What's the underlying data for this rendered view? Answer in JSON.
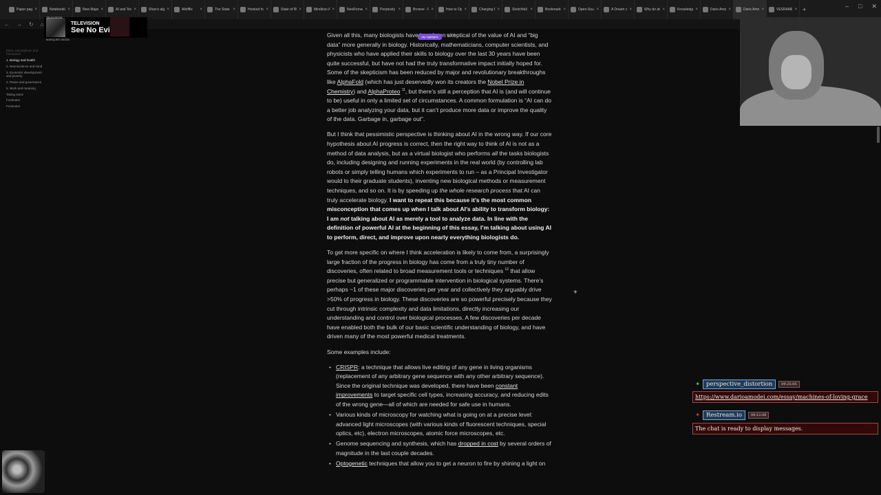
{
  "tabs": [
    "Paper page -",
    "NotebookLM",
    "New Major Tr",
    "AI and Techn",
    "Shan's algorit",
    "Allofflix",
    "The State of A",
    "Hooked for al",
    "State of RL fo",
    "Mindless AI",
    "NeoRomant",
    "Perplexity - Tec",
    "Browse - Rich",
    "How to Opti",
    "Charging Bui",
    "Sketchfall on X",
    "Bookmarks",
    "Open-Source",
    "A Dream of S",
    "Why do atten",
    "Knowledge G",
    "Dario Amodei",
    "Dario Amodei",
    "VESRAME A"
  ],
  "browser": {
    "url_fragment": "dario"
  },
  "now_playing": {
    "band": "TELEVISION",
    "song": "See No Evil",
    "art_top": "TELEVISION",
    "art_bottom": "MARQUEE MOON"
  },
  "toc": {
    "items": [
      "Basic assumptions and framework",
      "1. Biology and health",
      "2. Neuroscience and mind",
      "3. Economic development and poverty",
      "4. Peace and governance",
      "5. Work and meaning",
      "Taking stock",
      "Footnotes",
      "Footnotes"
    ]
  },
  "clip": {
    "highlight_label": "clip highlights",
    "tools": "↕ ⧉  × ⎘"
  },
  "article": {
    "p1": {
      "a": "Given all this, many biologists have long been skeptical of the value of AI and “big data” more generally in biology. Historically, mathematicians, computer scientists, and physicists who have applied their skills to biology over the last 30 years have been quite successful, but have not had the truly transformative impact initially hoped for. Some of the skepticism has been reduced by major and revolutionary breakthroughs like ",
      "link1": "AlphaFold",
      "b": " (which has just deservedly won its creators the ",
      "link2": "Nobel Prize in Chemistry",
      "c": ") and ",
      "link3": "AlphaProteo",
      "sup": "11",
      "d": ", but there’s still a perception that AI is (and will continue to be) useful in only a limited set of circumstances. A common formulation is “AI can do a better job analyzing your data, but it can’t produce more data or improve the quality of the data. Garbage in, garbage out”."
    },
    "p2": {
      "a": "But I think that pessimistic perspective is thinking about AI in the wrong way. If our core hypothesis about AI progress is correct, then the right way to think of AI is not as a method of data analysis, but as a virtual biologist who performs ",
      "em1": "all",
      "b": " the tasks biologists do, including designing and running experiments in the real world (by controlling lab robots or simply telling humans which experiments to run – as a Principal Investigator would to their graduate students), inventing new biological methods or measurement techniques, and so on. It is by speeding up ",
      "em2": "the whole research process",
      "c": " that AI can truly accelerate biology. ",
      "bold1": "I want to repeat this because it’s the most common misconception that comes up when I talk about AI’s ability to transform biology: I am ",
      "bold_em": "not",
      "bold2": " talking about AI as merely a tool to analyze data. In line with the definition of powerful AI at the beginning of this essay, I’m talking about using AI to perform, direct, and improve upon nearly everything biologists do."
    },
    "p3": {
      "a": "To get more specific on where I think acceleration is likely to come from, a surprisingly large fraction of the progress in biology has come from a truly tiny number of discoveries, often related to broad measurement tools or techniques",
      "sup": "12",
      "b": " that allow precise but generalized or programmable intervention in biological systems. There’s perhaps ~1 of these major discoveries per year and collectively they arguably drive >50% of progress in biology. These discoveries are so powerful precisely because they cut through intrinsic complexity and data limitations, directly increasing our understanding and control over biological processes. A few discoveries per decade have enabled both the bulk of our basic scientific understanding of biology, and have driven many of the most powerful medical treatments."
    },
    "p4": "Some examples include:",
    "bullets": {
      "b1": {
        "link": "CRISPR",
        "a": ": a technique that allows live editing of any gene in living organisms (replacement of any arbitrary gene sequence with any other arbitrary sequence). Since the original technique was developed, there have been ",
        "link2": "constant improvements",
        "b": " to target specific cell types, increasing accuracy, and reducing edits of the wrong gene—all of which are needed for safe use in humans."
      },
      "b2": "Various kinds of microscopy for watching what is going on at a precise level: advanced light microscopes (with various kinds of fluorescent techniques, special optics, etc), electron microscopes, atomic force microscopes, etc.",
      "b3": {
        "a": "Genome sequencing and synthesis, which has ",
        "link": "dropped in cost",
        "b": " by several orders of magnitude in the last couple decades."
      },
      "b4": {
        "link": "Optogenetic",
        "a": " techniques that allow you to get a neuron to fire by shining a light on"
      }
    }
  },
  "chat": {
    "msg1": {
      "user": "perspective_distortion",
      "time": "09:25:05",
      "text": "https://www.darioamodei.com/essay/machines-of-loving-grace",
      "icon_color": "#3fd03f"
    },
    "msg2": {
      "user": "Restream.io",
      "time": "09:12:08",
      "text": "The chat is ready to display messages.",
      "icon_color": "#d04040"
    }
  }
}
